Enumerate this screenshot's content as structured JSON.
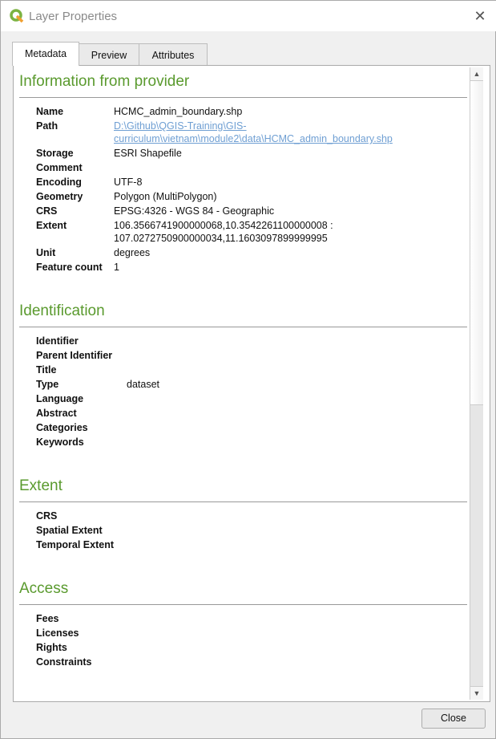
{
  "window": {
    "title": "Layer Properties",
    "close_icon": "close-icon"
  },
  "tabs": [
    {
      "label": "Metadata",
      "active": true
    },
    {
      "label": "Preview"
    },
    {
      "label": "Attributes"
    }
  ],
  "sections": {
    "provider": {
      "heading": "Information from provider",
      "rows": [
        {
          "label": "Name",
          "value": "HCMC_admin_boundary.shp"
        },
        {
          "label": "Path",
          "value_line1": "D:\\Github\\QGIS-Training\\GIS-",
          "value_line2": "curriculum\\vietnam\\module2\\data\\HCMC_admin_boundary.shp"
        },
        {
          "label": "Storage",
          "value": "ESRI Shapefile"
        },
        {
          "label": "Comment",
          "value": ""
        },
        {
          "label": "Encoding",
          "value": "UTF-8"
        },
        {
          "label": "Geometry",
          "value": "Polygon (MultiPolygon)"
        },
        {
          "label": "CRS",
          "value": "EPSG:4326 - WGS 84 - Geographic"
        },
        {
          "label": "Extent",
          "value_line1": "106.3566741900000068,10.3542261100000008 :",
          "value_line2": "107.0272750900000034,11.1603097899999995"
        },
        {
          "label": "Unit",
          "value": "degrees"
        },
        {
          "label": "Feature count",
          "value": "1"
        }
      ]
    },
    "identification": {
      "heading": "Identification",
      "rows": [
        {
          "label": "Identifier"
        },
        {
          "label": "Parent Identifier"
        },
        {
          "label": "Title"
        },
        {
          "label": "Type",
          "value": "dataset"
        },
        {
          "label": "Language"
        },
        {
          "label": "Abstract"
        },
        {
          "label": "Categories"
        },
        {
          "label": "Keywords"
        }
      ]
    },
    "extent": {
      "heading": "Extent",
      "rows": [
        {
          "label": "CRS"
        },
        {
          "label": "Spatial Extent"
        },
        {
          "label": "Temporal Extent"
        }
      ]
    },
    "access": {
      "heading": "Access",
      "rows": [
        {
          "label": "Fees"
        },
        {
          "label": "Licenses"
        },
        {
          "label": "Rights"
        },
        {
          "label": "Constraints"
        }
      ]
    }
  },
  "colors": {
    "heading": "#5a9a2e",
    "link": "#6f9fd3"
  },
  "footer": {
    "close_label": "Close"
  }
}
